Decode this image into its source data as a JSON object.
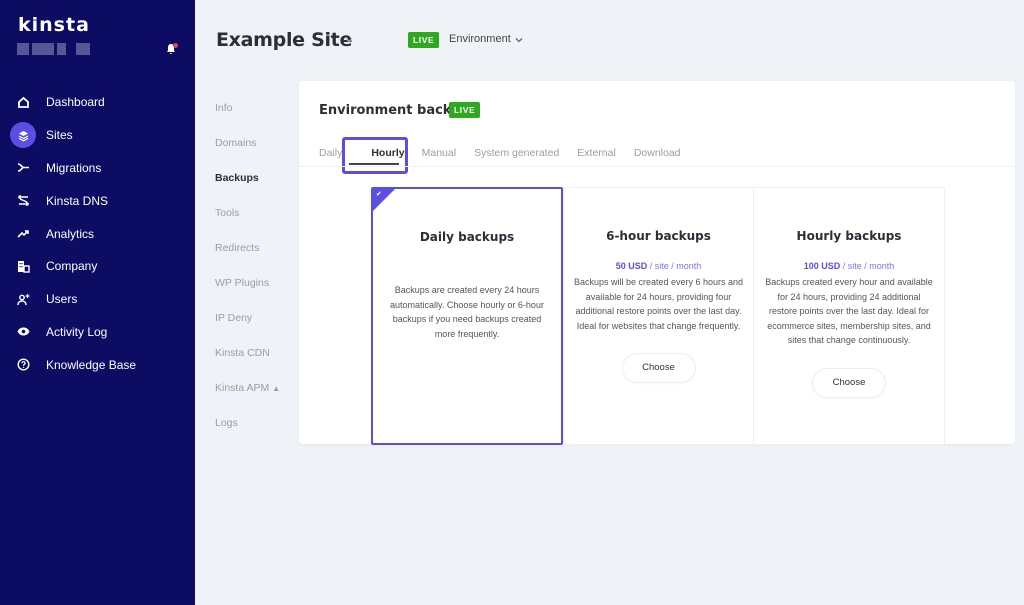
{
  "sidebar": {
    "logo": "kinsta",
    "notification_dot_color": "#e8444f",
    "items": [
      {
        "label": "Dashboard",
        "icon": "home-icon"
      },
      {
        "label": "Sites",
        "icon": "layers-icon",
        "active": true
      },
      {
        "label": "Migrations",
        "icon": "migrate-icon"
      },
      {
        "label": "Kinsta DNS",
        "icon": "dns-icon"
      },
      {
        "label": "Analytics",
        "icon": "trend-icon"
      },
      {
        "label": "Company",
        "icon": "building-icon"
      },
      {
        "label": "Users",
        "icon": "add-user-icon"
      },
      {
        "label": "Activity Log",
        "icon": "eye-icon"
      },
      {
        "label": "Knowledge Base",
        "icon": "help-icon"
      }
    ]
  },
  "header": {
    "site_title": "Example Site",
    "env_badge": "LIVE",
    "env_label": "Environment"
  },
  "subnav": {
    "items": [
      "Info",
      "Domains",
      "Backups",
      "Tools",
      "Redirects",
      "WP Plugins",
      "IP Deny",
      "Kinsta CDN",
      "Kinsta APM",
      "Logs"
    ],
    "active": "Backups"
  },
  "card": {
    "title": "Environment backups",
    "badge": "LIVE",
    "tabs": [
      "Daily",
      "Hourly",
      "Manual",
      "System generated",
      "External",
      "Download"
    ],
    "active_tab": "Hourly",
    "plans": [
      {
        "title": "Daily backups",
        "selected": true,
        "description": "Backups are created every 24 hours automatically. Choose hourly or 6-hour backups if you need backups created more frequently."
      },
      {
        "title": "6-hour backups",
        "price": "50 USD",
        "price_unit": " / site / month",
        "description": "Backups will be created every 6 hours and available for 24 hours, providing four additional restore points over the last day. Ideal for websites that change frequently.",
        "button": "Choose"
      },
      {
        "title": "Hourly backups",
        "price": "100 USD",
        "price_unit": " / site / month",
        "description": "Backups created every hour and available for 24 hours, providing 24 additional restore points over the last day. Ideal for ecommerce sites, membership sites, and sites that change continuously.",
        "button": "Choose"
      }
    ]
  },
  "colors": {
    "sidebar_bg": "#0b0c62",
    "accent": "#5a4fe0",
    "live_green": "#2ea81f"
  }
}
